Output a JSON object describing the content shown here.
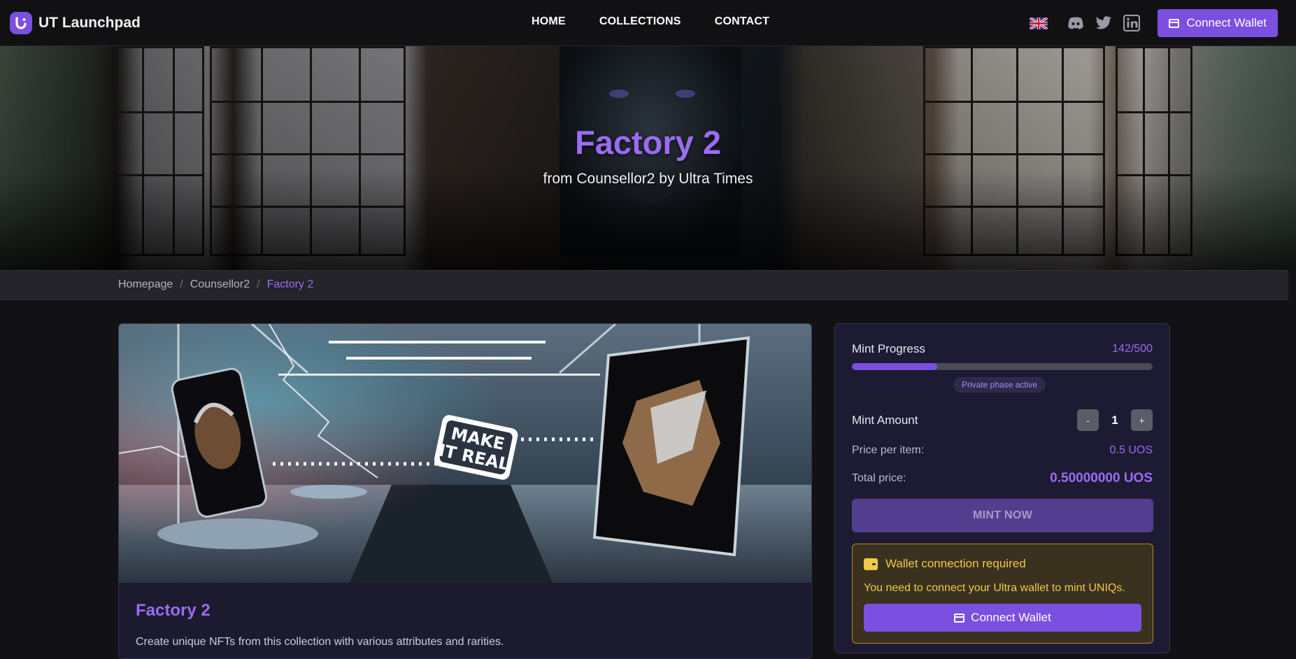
{
  "app": {
    "name": "UT Launchpad"
  },
  "nav": {
    "links": [
      {
        "label": "HOME"
      },
      {
        "label": "COLLECTIONS"
      },
      {
        "label": "CONTACT"
      }
    ],
    "icons": [
      "uk-flag-icon",
      "discord-icon",
      "twitter-icon",
      "linkedin-icon"
    ],
    "connect_label": "Connect Wallet"
  },
  "hero": {
    "title": "Factory 2",
    "subtitle": "from Counsellor2 by Ultra Times"
  },
  "breadcrumb": {
    "items": [
      "Homepage",
      "Counsellor2",
      "Factory 2"
    ],
    "separator": "/"
  },
  "collection": {
    "title": "Factory 2",
    "description": "Create unique NFTs from this collection with various attributes and rarities."
  },
  "mint": {
    "progress_label": "Mint Progress",
    "progress_text": "142/500",
    "progress_fraction": 0.284,
    "phase_badge": "Private phase active",
    "amount_label": "Mint Amount",
    "amount_value": "1",
    "decrement_label": "-",
    "increment_label": "+",
    "price_label": "Price per item:",
    "price_value": "0.5 UOS",
    "total_label": "Total price:",
    "total_value": "0.50000000 UOS",
    "mint_button": "MINT NOW"
  },
  "wallet_notice": {
    "title": "Wallet connection required",
    "message": "You need to connect your Ultra wallet to mint UNIQs.",
    "button": "Connect Wallet"
  },
  "colors": {
    "accent": "#7b4fe0",
    "accent_text": "#9b6cf2",
    "warning": "#f2c84b",
    "background": "#121216"
  }
}
